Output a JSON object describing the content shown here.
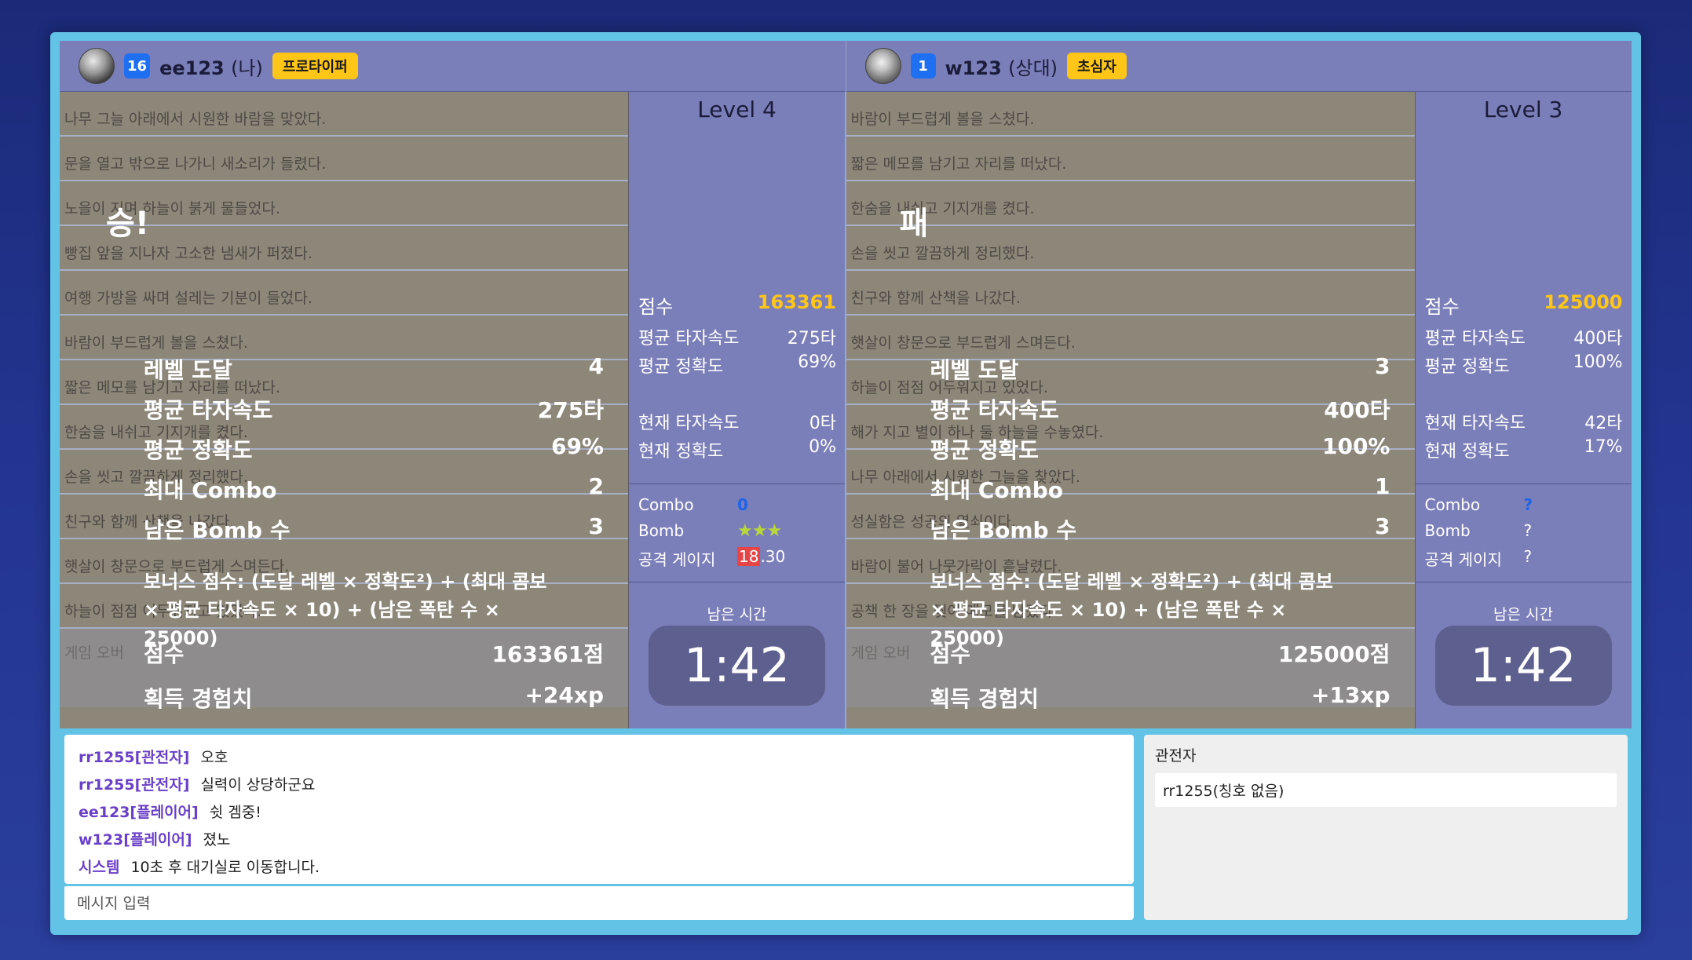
{
  "players": [
    {
      "level": "16",
      "name": "ee123",
      "role": "(나)",
      "rank": "프로타이퍼",
      "lines": [
        "나무 그늘 아래에서 시원한 바람을 맞았다.",
        "문을 열고 밖으로 나가니 새소리가 들렸다.",
        "노을이 지며 하늘이 붉게 물들었다.",
        "빵집 앞을 지나자 고소한 냄새가 퍼졌다.",
        "여행 가방을 싸며 설레는 기분이 들었다.",
        "바람이 부드럽게 볼을 스쳤다.",
        "짧은 메모를 남기고 자리를 떠났다.",
        "한숨을 내쉬고 기지개를 켰다.",
        "손을 씻고 깔끔하게 정리했다.",
        "친구와 함께 산책을 나갔다.",
        "햇살이 창문으로 부드럽게 스며든다.",
        "하늘이 점점 어두워지고 있었다."
      ],
      "game_over": "게임 오버",
      "result": {
        "title": "승!",
        "rows": [
          {
            "label": "레벨 도달",
            "value": "4"
          },
          {
            "label": "평균 타자속도",
            "value": "275타"
          },
          {
            "label": "평균 정확도",
            "value": "69%"
          },
          {
            "label": "최대 Combo",
            "value": "2"
          },
          {
            "label": "남은 Bomb 수",
            "value": "3"
          }
        ],
        "formula": "보너스 점수: (도달 레벨 × 정확도²) + (최대 콤보 × 평균 타자속도 × 10) + (남은 폭탄 수 × 25000)",
        "score_label": "점수",
        "score": "163361점",
        "xp_label": "획득 경험치",
        "xp": "+24xp"
      },
      "side": {
        "level": "Level 4",
        "score_label": "점수",
        "score": "163361",
        "avg_speed_label": "평균 타자속도",
        "avg_speed": "275타",
        "avg_acc_label": "평균 정확도",
        "avg_acc": "69%",
        "cur_speed_label": "현재 타자속도",
        "cur_speed": "0타",
        "cur_acc_label": "현재 정확도",
        "cur_acc": "0%",
        "combo_label": "Combo",
        "combo": "0",
        "bomb_label": "Bomb",
        "bomb": "★★★",
        "gauge_label": "공격 게이지",
        "gauge_hi": "18",
        "gauge_rest": ".30",
        "time_label": "남은 시간",
        "time": "1:42"
      }
    },
    {
      "level": "1",
      "name": "w123",
      "role": "(상대)",
      "rank": "초심자",
      "lines": [
        "바람이 부드럽게 볼을 스쳤다.",
        "짧은 메모를 남기고 자리를 떠났다.",
        "한숨을 내쉬고 기지개를 켰다.",
        "손을 씻고 깔끔하게 정리했다.",
        "친구와 함께 산책을 나갔다.",
        "햇살이 창문으로 부드럽게 스며든다.",
        "하늘이 점점 어두워지고 있었다.",
        "해가 지고 별이 하나 둘 하늘을 수놓였다.",
        "나무 아래에서 시원한 그늘을 찾았다.",
        "성실함은 성공의 열쇠이다.",
        "바람이 불어 나뭇가락이 흩날렸다.",
        "공책 한 장을 찢어 메모를 남겼다."
      ],
      "game_over": "게임 오버",
      "result": {
        "title": "패",
        "rows": [
          {
            "label": "레벨 도달",
            "value": "3"
          },
          {
            "label": "평균 타자속도",
            "value": "400타"
          },
          {
            "label": "평균 정확도",
            "value": "100%"
          },
          {
            "label": "최대 Combo",
            "value": "1"
          },
          {
            "label": "남은 Bomb 수",
            "value": "3"
          }
        ],
        "formula": "보너스 점수: (도달 레벨 × 정확도²) + (최대 콤보 × 평균 타자속도 × 10) + (남은 폭탄 수 × 25000)",
        "score_label": "점수",
        "score": "125000점",
        "xp_label": "획득 경험치",
        "xp": "+13xp"
      },
      "side": {
        "level": "Level 3",
        "score_label": "점수",
        "score": "125000",
        "avg_speed_label": "평균 타자속도",
        "avg_speed": "400타",
        "avg_acc_label": "평균 정확도",
        "avg_acc": "100%",
        "cur_speed_label": "현재 타자속도",
        "cur_speed": "42타",
        "cur_acc_label": "현재 정확도",
        "cur_acc": "17%",
        "combo_label": "Combo",
        "combo": "?",
        "bomb_label": "Bomb",
        "bomb": "?",
        "gauge_label": "공격 게이지",
        "gauge_hi": "",
        "gauge_rest": "?",
        "time_label": "남은 시간",
        "time": "1:42"
      }
    }
  ],
  "chat": {
    "messages": [
      {
        "who": "rr1255[관전자]",
        "text": "오호"
      },
      {
        "who": "rr1255[관전자]",
        "text": "실력이 상당하군요"
      },
      {
        "who": "ee123[플레이어]",
        "text": "쉿 겜중!"
      },
      {
        "who": "w123[플레이어]",
        "text": "졌노"
      },
      {
        "who": "시스템",
        "text": "10초 후 대기실로 이동합니다."
      }
    ],
    "placeholder": "메시지 입력"
  },
  "spectators": {
    "title": "관전자",
    "items": [
      "rr1255(칭호 없음)"
    ]
  },
  "colors": {
    "accent_blue": "#1e6ff2",
    "rank_yellow": "#ffc617",
    "score_yellow": "#ffc617",
    "panel_purple": "#7b7fb9",
    "chat_name_purple": "#6a40c8"
  }
}
